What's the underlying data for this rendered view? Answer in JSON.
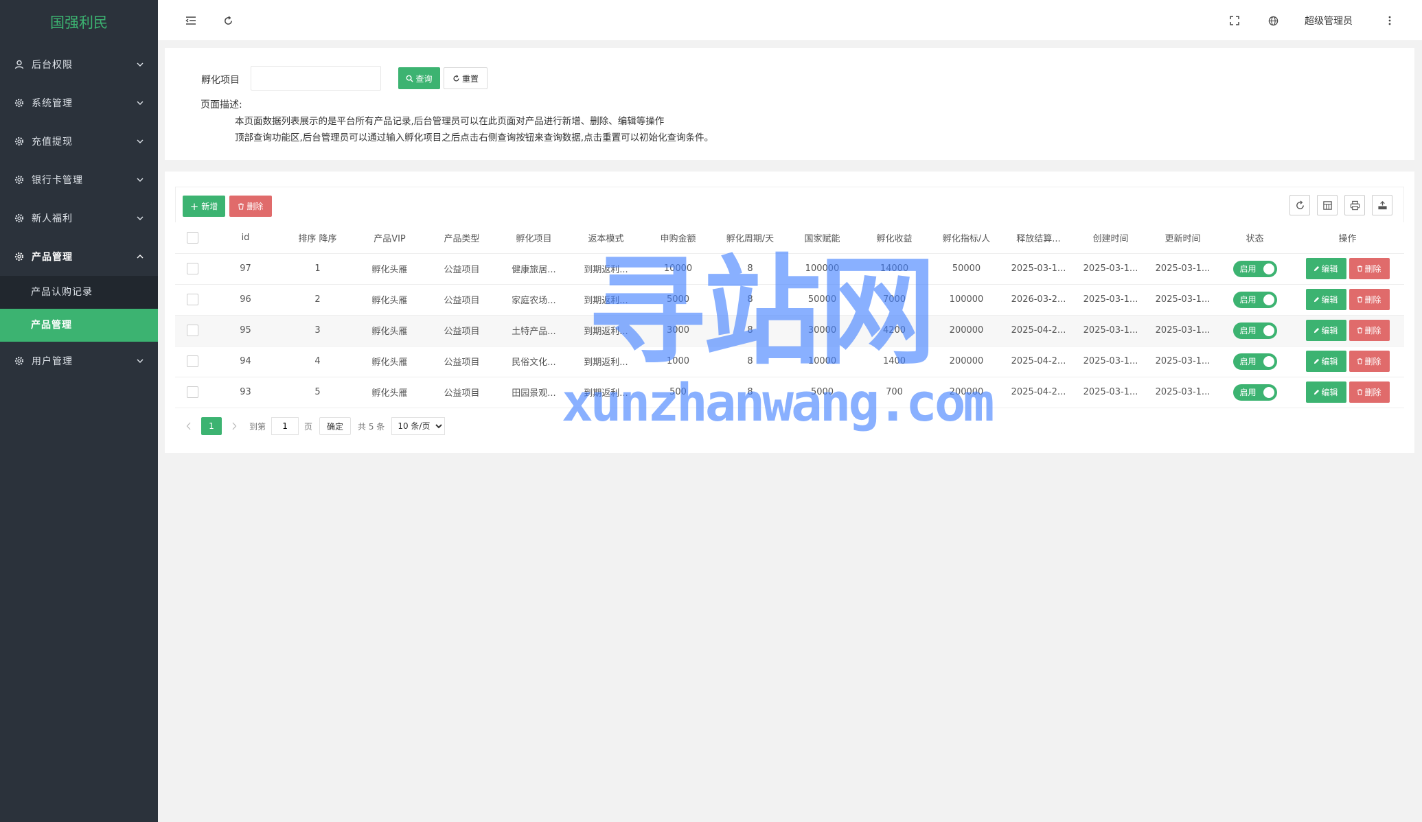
{
  "app": {
    "title": "国强利民"
  },
  "sidebar": {
    "items": [
      {
        "label": "后台权限",
        "icon": "user-icon"
      },
      {
        "label": "系统管理",
        "icon": "gear-icon"
      },
      {
        "label": "充值提现",
        "icon": "gear-icon"
      },
      {
        "label": "银行卡管理",
        "icon": "gear-icon"
      },
      {
        "label": "新人福利",
        "icon": "gear-icon"
      },
      {
        "label": "产品管理",
        "icon": "gear-icon"
      },
      {
        "label": "用户管理",
        "icon": "gear-icon"
      }
    ],
    "submenu": [
      {
        "label": "产品认购记录"
      },
      {
        "label": "产品管理"
      }
    ]
  },
  "topbar": {
    "user": "超级管理员"
  },
  "search": {
    "label": "孵化项目",
    "placeholder": "",
    "search_btn": "查询",
    "reset_btn": "重置",
    "desc_title": "页面描述:",
    "desc_lines": [
      "本页面数据列表展示的是平台所有产品记录,后台管理员可以在此页面对产品进行新增、删除、编辑等操作",
      "顶部查询功能区,后台管理员可以通过输入孵化项目之后点击右侧查询按钮来查询数据,点击重置可以初始化查询条件。"
    ]
  },
  "toolbar": {
    "add": "新增",
    "delete": "删除"
  },
  "table": {
    "columns": [
      "id",
      "排序 降序",
      "产品VIP",
      "产品类型",
      "孵化项目",
      "返本模式",
      "申购金额",
      "孵化周期/天",
      "国家赋能",
      "孵化收益",
      "孵化指标/人",
      "释放结算...",
      "创建时间",
      "更新时间",
      "状态",
      "操作"
    ],
    "rows": [
      [
        "97",
        "1",
        "孵化头雁",
        "公益项目",
        "健康旅居...",
        "到期返利...",
        "10000",
        "8",
        "100000",
        "14000",
        "50000",
        "2025-03-1...",
        "2025-03-1...",
        "2025-03-1..."
      ],
      [
        "96",
        "2",
        "孵化头雁",
        "公益项目",
        "家庭农场...",
        "到期返利...",
        "5000",
        "8",
        "50000",
        "7000",
        "100000",
        "2026-03-2...",
        "2025-03-1...",
        "2025-03-1..."
      ],
      [
        "95",
        "3",
        "孵化头雁",
        "公益项目",
        "土特产品...",
        "到期返利...",
        "3000",
        "8",
        "30000",
        "4200",
        "200000",
        "2025-04-2...",
        "2025-03-1...",
        "2025-03-1..."
      ],
      [
        "94",
        "4",
        "孵化头雁",
        "公益项目",
        "民俗文化...",
        "到期返利...",
        "1000",
        "8",
        "10000",
        "1400",
        "200000",
        "2025-04-2...",
        "2025-03-1...",
        "2025-03-1..."
      ],
      [
        "93",
        "5",
        "孵化头雁",
        "公益项目",
        "田园景观...",
        "到期返利...",
        "500",
        "8",
        "5000",
        "700",
        "200000",
        "2025-04-2...",
        "2025-03-1...",
        "2025-03-1..."
      ]
    ],
    "status_label": "启用",
    "edit_label": "编辑",
    "delete_label": "删除"
  },
  "pager": {
    "current": "1",
    "goto": "到第",
    "page_value": "1",
    "page_unit": "页",
    "ok": "确定",
    "total": "共 5 条",
    "size": "10 条/页"
  },
  "watermark": {
    "big": "寻站网",
    "small": "xunzhanwang.com"
  }
}
